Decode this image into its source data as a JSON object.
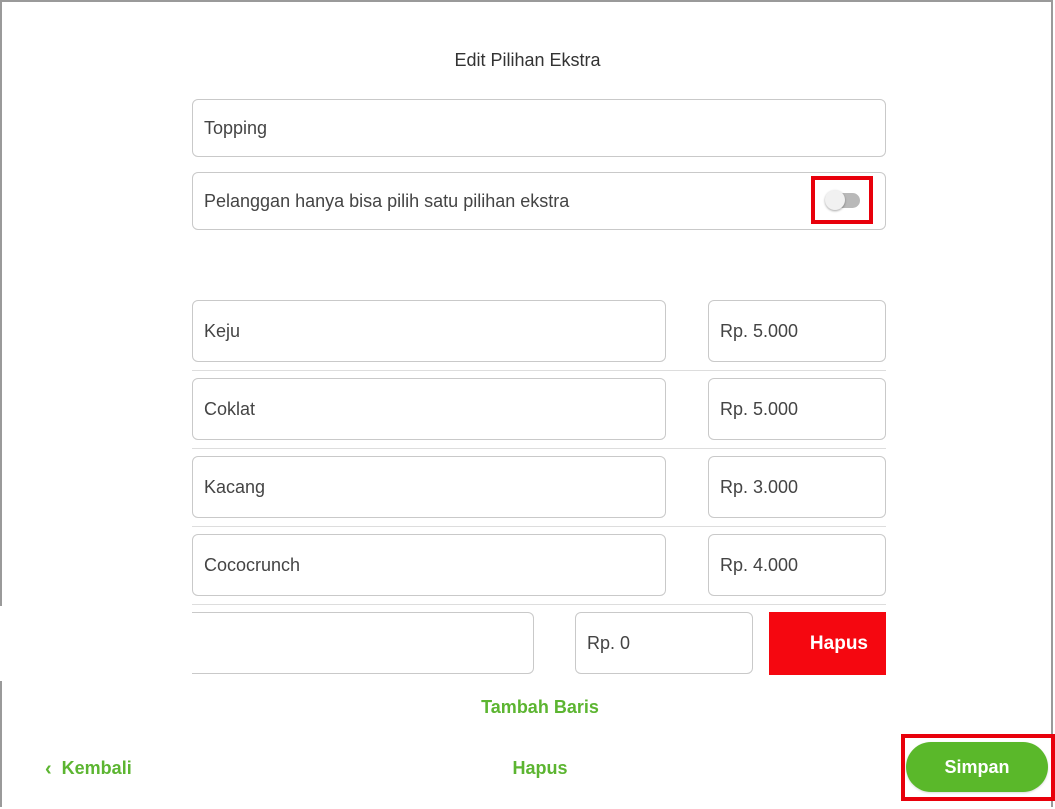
{
  "dialog": {
    "title": "Edit Pilihan Ekstra",
    "group_name": "Topping",
    "single_choice_label": "Pelanggan hanya bisa pilih satu pilihan ekstra",
    "single_choice_enabled": false
  },
  "options": [
    {
      "name": "Keju",
      "price": "Rp. 5.000"
    },
    {
      "name": "Coklat",
      "price": "Rp. 5.000"
    },
    {
      "name": "Kacang",
      "price": "Rp. 3.000"
    },
    {
      "name": "Cococrunch",
      "price": "Rp. 4.000"
    }
  ],
  "new_row": {
    "name": "",
    "price": "Rp. 0",
    "delete_label": "Hapus"
  },
  "add_row_label": "Tambah Baris",
  "footer": {
    "back_label": "Kembali",
    "delete_label": "Hapus",
    "save_label": "Simpan"
  },
  "colors": {
    "accent_green": "#5cb531",
    "danger_red": "#f50710",
    "highlight_red": "#e8000b"
  }
}
